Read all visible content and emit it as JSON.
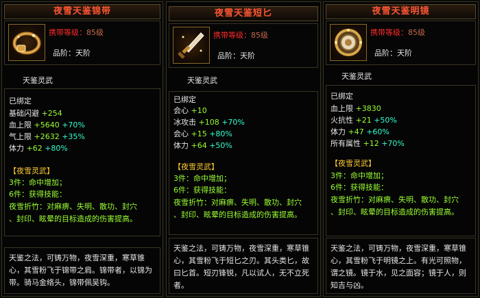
{
  "panels": [
    {
      "title": "夜雪天鉴锦带",
      "req_label": "携带等级：",
      "req_value": "85级",
      "grade": "品阶：天阶",
      "set_name": "天鉴灵武",
      "bound": "已绑定",
      "attrs": [
        {
          "name": "基础闪避",
          "value": "+254",
          "pct": ""
        },
        {
          "name": "血上限",
          "value": "+5640",
          "pct": "+70%"
        },
        {
          "name": "气上限",
          "value": "+2632",
          "pct": "+35%"
        },
        {
          "name": "体力",
          "value": "+62",
          "pct": "+80%"
        }
      ],
      "set_title": "【夜雪灵武】",
      "set_3": "3件：命中增加；",
      "set_6": "6件：获得技能：",
      "skill_1": "夜雪折竹：对麻痹、失明、散功、封穴",
      "skill_2": "、封印、眩晕的目标造成的伤害提高。",
      "desc": "天鉴之法，可铸万物，夜雪深重，寒草锥心，其雪粉飞于锦带之肩。锦带者，以锦为带。骑马金络头，锦带佩吴钩。"
    },
    {
      "title": "夜雪天鉴短匕",
      "req_label": "携带等级：",
      "req_value": "85级",
      "grade": "品阶：天阶",
      "set_name": "天鉴灵武",
      "bound": "已绑定",
      "attrs": [
        {
          "name": "会心",
          "value": "+10",
          "pct": ""
        },
        {
          "name": "冰攻击",
          "value": "+108",
          "pct": "+70%"
        },
        {
          "name": "会心",
          "value": "+15",
          "pct": "+80%"
        },
        {
          "name": "体力",
          "value": "+64",
          "pct": "+50%"
        }
      ],
      "set_title": "【夜雪灵武】",
      "set_3": "3件：命中增加；",
      "set_6": "6件：获得技能：",
      "skill_1": "夜雪折竹：对麻痹、失明、散功、封穴",
      "skill_2": "、封印、眩晕的目标造成的伤害提高。",
      "desc": "天鉴之法，可铸万物，夜雪深重，寒草锥心，其雪粉飞于短匕之刃。其头类匕，故曰匕首。短刃锋锐，凡以试人，无不立死者。"
    },
    {
      "title": "夜雪天鉴明镜",
      "req_label": "携带等级：",
      "req_value": "85级",
      "grade": "品阶：天阶",
      "set_name": "天鉴灵武",
      "bound": "已绑定",
      "attrs": [
        {
          "name": "血上限",
          "value": "+3830",
          "pct": ""
        },
        {
          "name": "火抗性",
          "value": "+21",
          "pct": "+50%"
        },
        {
          "name": "体力",
          "value": "+47",
          "pct": "+60%"
        },
        {
          "name": "所有属性",
          "value": "+12",
          "pct": "+70%"
        }
      ],
      "set_title": "【夜雪灵武】",
      "set_3": "3件：命中增加；",
      "set_6": "6件：获得技能：",
      "skill_1": "夜雪折竹：对麻痹、失明、散功、封穴",
      "skill_2": "、封印、眩晕的目标造成的伤害提高。",
      "desc": "天鉴之法，可铸万物，夜雪深重，寒草锥心，其雪粉飞于明镜之上。有光可照物，谓之镜。镜于水，见之面容；镜于人，则知吉与凶。"
    }
  ]
}
